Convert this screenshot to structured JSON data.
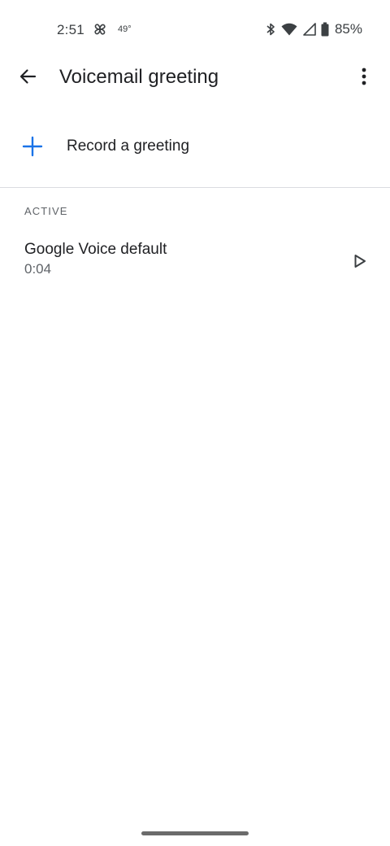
{
  "status_bar": {
    "time": "2:51",
    "temperature": "49°",
    "battery": "85%",
    "icons": [
      "pinwheel-icon",
      "bluetooth-icon",
      "wifi-icon",
      "cell-signal-icon",
      "battery-icon"
    ]
  },
  "app_bar": {
    "title": "Voicemail greeting",
    "back_icon": "arrow-back-icon",
    "more_icon": "more-vert-icon"
  },
  "record": {
    "label": "Record a greeting",
    "icon": "plus-icon"
  },
  "active_section": {
    "header": "ACTIVE",
    "items": [
      {
        "name": "Google Voice default",
        "duration": "0:04",
        "icon": "play-icon"
      }
    ]
  },
  "colors": {
    "accent": "#1a73e8",
    "text_primary": "#202124",
    "text_secondary": "#5f6368",
    "divider": "#dadce0"
  }
}
